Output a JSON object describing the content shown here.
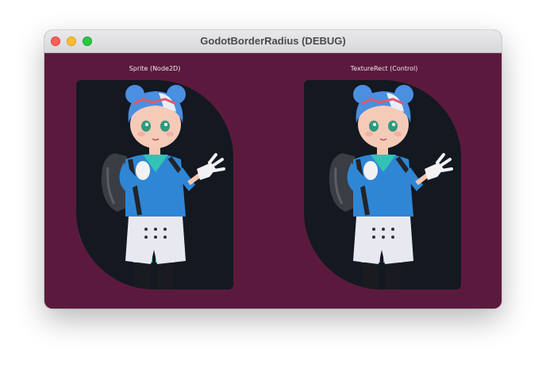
{
  "window": {
    "title": "GodotBorderRadius (DEBUG)"
  },
  "panels": [
    {
      "label": "Sprite (Node2D)"
    },
    {
      "label": "TextureRect (Control)"
    }
  ],
  "colors": {
    "background": "#5b1a3d",
    "panel": "#131821",
    "hair": "#4a8fe0",
    "shirt": "#2f86d4",
    "shorts": "#e8e9f0"
  }
}
